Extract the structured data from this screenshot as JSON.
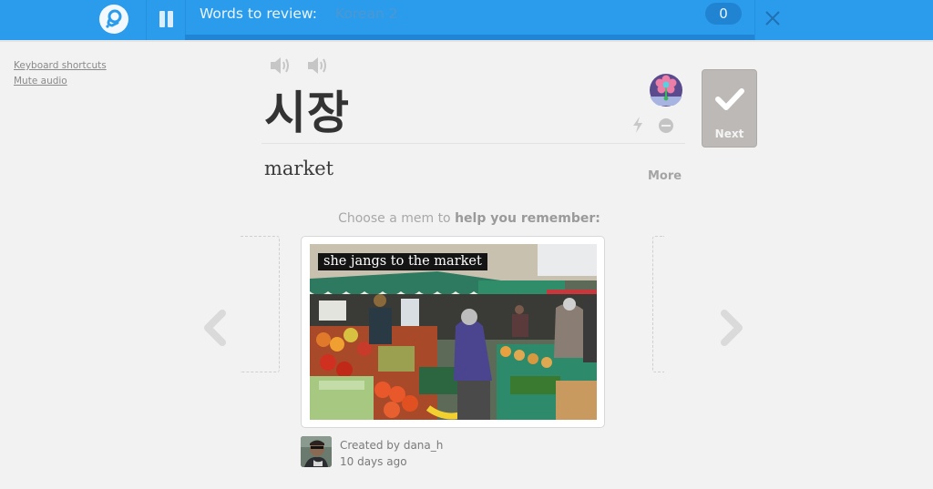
{
  "topbar": {
    "logo_icon": "memrise-logo-icon",
    "pause_icon": "pause-icon",
    "words_label": "Words to review:",
    "course_name": "Korean 2",
    "count": "0",
    "progress_fraction": 0,
    "close_icon": "close-icon",
    "colors": {
      "bar": "#2b9cec",
      "track": "#2185d5",
      "pill": "#2184d2"
    }
  },
  "side_links": [
    {
      "label": "Keyboard shortcuts"
    },
    {
      "label": "Mute audio"
    }
  ],
  "word_card": {
    "audio_buttons": [
      {
        "icon": "speaker-icon",
        "label": "Play audio 1"
      },
      {
        "icon": "speaker-icon",
        "label": "Play audio 2"
      }
    ],
    "word": "시장",
    "definition": "market",
    "more_label": "More",
    "status_icons": [
      "flower-plant-icon",
      "lightning-icon",
      "ignore-minus-icon"
    ],
    "next_label": "Next"
  },
  "mems": {
    "prompt_plain": "Choose a mem to ",
    "prompt_bold": "help you remember:",
    "current": {
      "caption": "she jangs to the market",
      "image_alt": "Outdoor market stalls with fruit and vegetables, woman in purple coat shopping",
      "creator": "Created by dana_h",
      "age": "10 days ago"
    },
    "prev_icon": "chevron-left-icon",
    "next_icon": "chevron-right-icon"
  }
}
